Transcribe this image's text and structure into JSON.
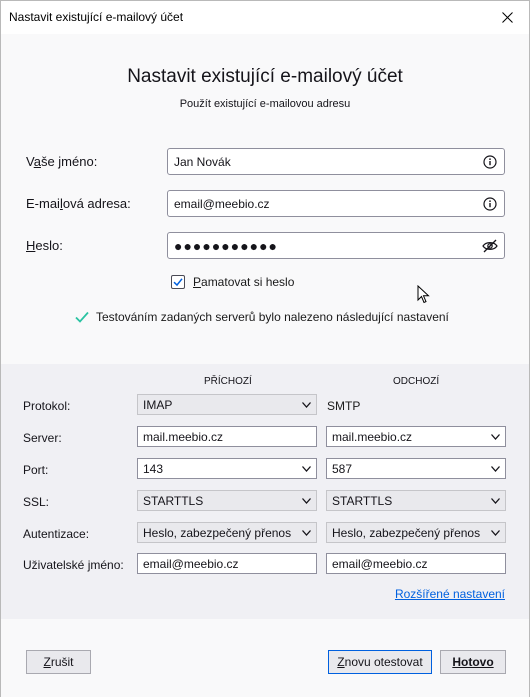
{
  "window": {
    "title": "Nastavit existující e-mailový účet"
  },
  "header": {
    "title": "Nastavit existující e-mailový účet",
    "subtitle": "Použít existující e-mailovou adresu"
  },
  "form": {
    "name_label_pre": "V",
    "name_label_u": "a",
    "name_label_post": "še jméno:",
    "name_value": "Jan Novák",
    "email_label_pre": "E-mai",
    "email_label_u": "l",
    "email_label_post": "ová adresa:",
    "email_value": "email@meebio.cz",
    "password_label_pre": "",
    "password_label_u": "H",
    "password_label_post": "eslo:",
    "password_value": "●●●●●●●●●●●",
    "remember_pre": "",
    "remember_u": "P",
    "remember_post": "amatovat si heslo",
    "remember_checked": true
  },
  "status": {
    "text": "Testováním zadaných serverů bylo nalezeno následující nastavení",
    "color": "#2ac3a2"
  },
  "config": {
    "incoming_header": "PŘÍCHOZÍ",
    "outgoing_header": "ODCHOZÍ",
    "rows": {
      "protocol": {
        "label": "Protokol:",
        "incoming": "IMAP",
        "outgoing": "SMTP"
      },
      "server": {
        "label": "Server:",
        "incoming": "mail.meebio.cz",
        "outgoing": "mail.meebio.cz"
      },
      "port": {
        "label": "Port:",
        "incoming": "143",
        "outgoing": "587"
      },
      "ssl": {
        "label": "SSL:",
        "incoming": "STARTTLS",
        "outgoing": "STARTTLS"
      },
      "auth": {
        "label": "Autentizace:",
        "incoming": "Heslo, zabezpečený přenos",
        "outgoing": "Heslo, zabezpečený přenos"
      },
      "username": {
        "label": "Uživatelské jméno:",
        "incoming": "email@meebio.cz",
        "outgoing": "email@meebio.cz"
      }
    },
    "advanced_link": "Rozšířené nastavení"
  },
  "footer": {
    "cancel": {
      "u": "Z",
      "post": "rušit"
    },
    "retest": {
      "u": "Z",
      "post": "novu otestovat"
    },
    "done": {
      "label": "Hotovo"
    }
  },
  "colors": {
    "accent": "#0060df",
    "success": "#2ac3a2",
    "config_bg": "#f0f0f4"
  },
  "icons": [
    "close-icon",
    "info-icon",
    "eye-slash-icon",
    "checkmark-icon",
    "chevron-down-icon",
    "mouse-cursor-icon"
  ]
}
